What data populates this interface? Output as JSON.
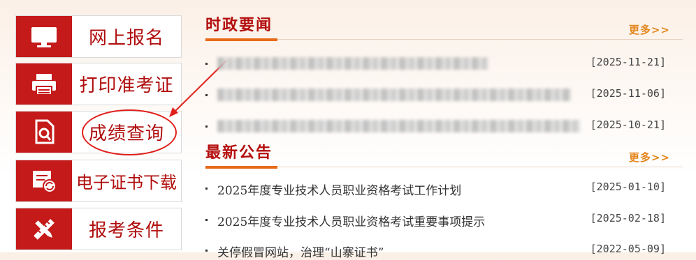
{
  "menu": [
    {
      "label": "网上报名",
      "icon": "monitor-icon"
    },
    {
      "label": "打印准考证",
      "icon": "printer-icon"
    },
    {
      "label": "成绩查询",
      "icon": "search-document-icon"
    },
    {
      "label": "电子证书下载",
      "icon": "certificate-download-icon"
    },
    {
      "label": "报考条件",
      "icon": "tools-icon"
    }
  ],
  "news": {
    "title": "时政要闻",
    "more": "更多>>",
    "items": [
      {
        "date": "[2025-11-21]"
      },
      {
        "date": "[2025-11-06]"
      },
      {
        "date": "[2025-10-21]"
      }
    ]
  },
  "notices": {
    "title": "最新公告",
    "more": "更多>>",
    "items": [
      {
        "title": "2025年度专业技术人员职业资格考试工作计划",
        "date": "[2025-01-10]"
      },
      {
        "title": "2025年度专业技术人员职业资格考试重要事项提示",
        "date": "[2025-02-18]"
      },
      {
        "title": "关停假冒网站，治理“山寨证书”",
        "date": "[2022-05-09]"
      }
    ]
  },
  "colors": {
    "primary_red": "#c51a1a",
    "accent_orange": "#e66a18",
    "more_link": "#e3861e"
  }
}
